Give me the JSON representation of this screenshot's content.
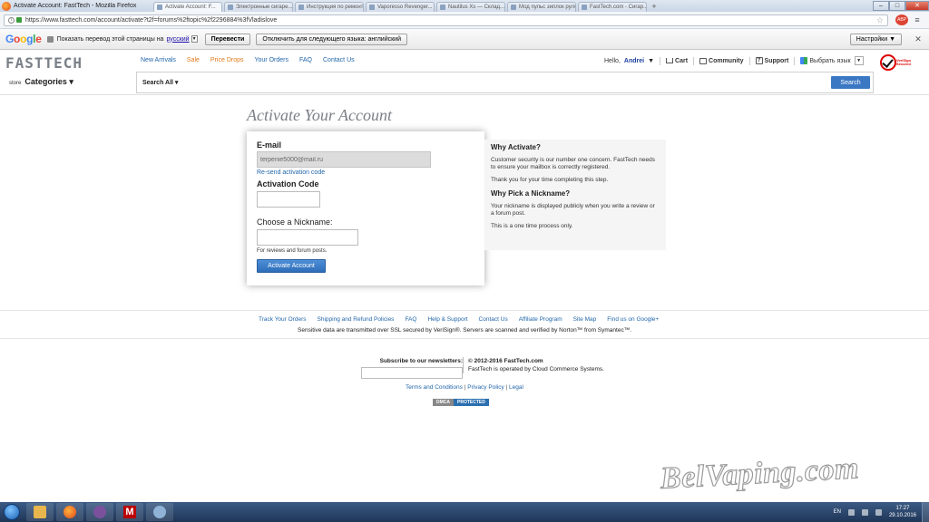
{
  "browser": {
    "window_title": "Activate Account: FastTech - Mozilla Firefox",
    "tabs": [
      "Activate Account: F...",
      "Электронные сигаре...",
      "Инструкция по ремонт...",
      "Vaporesso Revenger...",
      "Nautilus Xs — Склад...",
      "Мод пульс зиплок рулон...",
      "FastTech.com - Сигар..."
    ],
    "url": "https://www.fasttech.com/account/activate?t2f=forums%2ftopic%2f2296884%3fVladislove",
    "win_min": "–",
    "win_max": "□",
    "win_close": "✕",
    "addon_label": "ABP",
    "menu": "≡",
    "new_tab": "+"
  },
  "translate_bar": {
    "prompt": "Показать перевод этой страницы на",
    "language": "русский",
    "translate_btn": "Перевести",
    "disable_btn": "Отключить для следующего языка: английский",
    "settings_btn": "Настройки ▼",
    "close": "✕"
  },
  "site_header": {
    "logo": "FASTTECH",
    "nav": [
      "New Arrivals",
      "Sale",
      "Price Drops",
      "Your Orders",
      "FAQ",
      "Contact Us"
    ],
    "hello": "Hello,",
    "username": "Andrei",
    "cart": "Cart",
    "community": "Community",
    "support": "Support",
    "language": "Выбрать язык",
    "store_label": "store",
    "categories": "Categories ▾",
    "search_all": "Search All ▾",
    "search_btn": "Search",
    "verisign_text": "VeriSign Secured"
  },
  "activate": {
    "title": "Activate Your Account",
    "email_label": "E-mail",
    "email_value": "terpenie5000@mail.ru",
    "resend_link": "Re-send activation code",
    "code_label": "Activation Code",
    "nickname_label": "Choose a Nickname:",
    "nickname_hint": "For reviews and forum posts.",
    "submit_btn": "Activate Account"
  },
  "info": {
    "why_activate_title": "Why Activate?",
    "why_activate_p1": "Customer security is our number one concern. FastTech needs to ensure your mailbox is correctly registered.",
    "why_activate_p2": "Thank you for your time completing this step.",
    "why_nick_title": "Why Pick a Nickname?",
    "why_nick_p1": "Your nickname is displayed publicly when you write a review or a forum post.",
    "why_nick_p2": "This is a one time process only."
  },
  "footer": {
    "links": [
      "Track Your Orders",
      "Shipping and Refund Policies",
      "FAQ",
      "Help & Support",
      "Contact Us",
      "Affiliate Program",
      "Site Map",
      "Find us on Google+"
    ],
    "ssl_note": "Sensitive data are transmitted over SSL secured by VeriSign®. Servers are scanned and verified by Norton™ from Symantec™.",
    "newsletter_label": "Subscribe to our newsletters:",
    "copyright": "© 2012-2016 FastTech.com",
    "operated": "FastTech is operated by Cloud Commerce Systems.",
    "terms": "Terms and Conditions",
    "privacy": "Privacy Policy",
    "legal": "Legal",
    "legal_sep": "|",
    "dmca": "DMCA",
    "protected": "PROTECTED"
  },
  "watermark": "BelVaping.com",
  "taskbar": {
    "lang": "EN",
    "time": "17:27",
    "date": "29.10.2016",
    "m_label": "M"
  }
}
